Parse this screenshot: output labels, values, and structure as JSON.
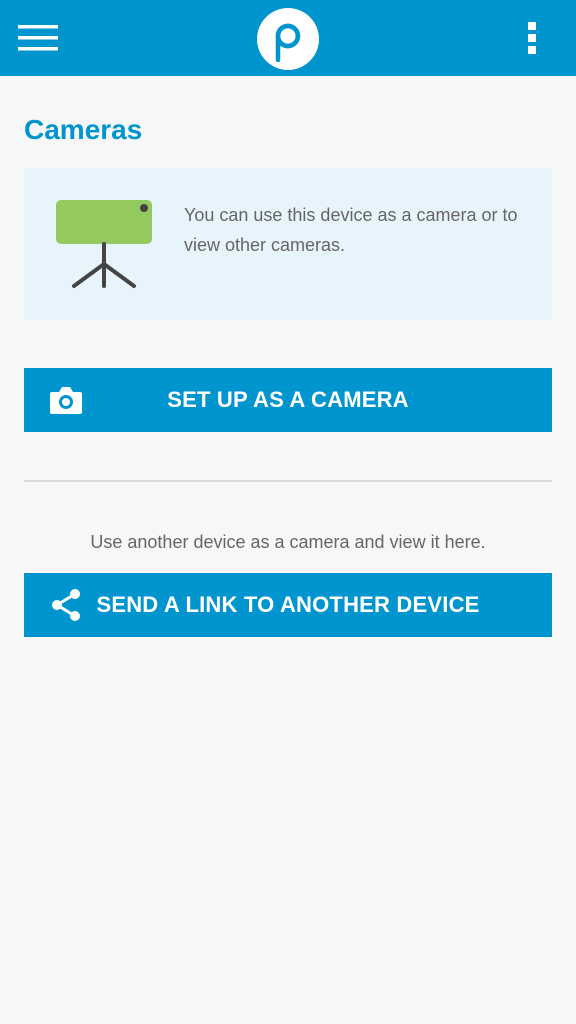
{
  "header": {
    "menu_icon": "hamburger-menu-icon",
    "logo_letter": "p",
    "overflow_icon": "more-vertical-icon",
    "color": "#0095cf"
  },
  "page": {
    "title": "Cameras"
  },
  "info_card": {
    "illustration": "camera-on-tripod-icon",
    "text": "You can use this device as a camera or to view other cameras."
  },
  "setup_button": {
    "icon": "camera-icon",
    "label": "SET UP AS A CAMERA"
  },
  "hint": {
    "text": "Use another device as a camera and view it here."
  },
  "share_button": {
    "icon": "share-icon",
    "label": "SEND A LINK TO ANOTHER DEVICE"
  },
  "colors": {
    "accent": "#0095cf",
    "card_bg": "#e8f4fb",
    "illustration_green": "#94c95d",
    "background": "#f7f7f7"
  }
}
